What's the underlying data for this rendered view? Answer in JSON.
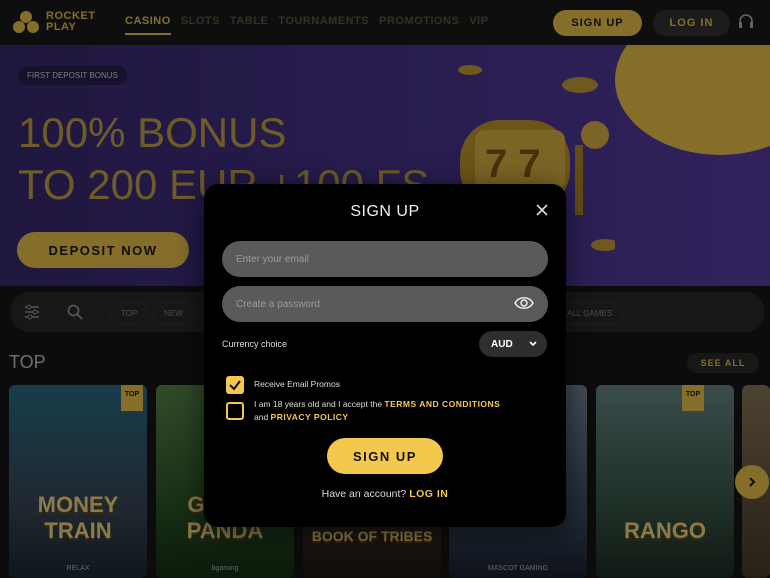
{
  "header": {
    "logo_text": [
      "ROCKET",
      "PLAY"
    ],
    "nav": [
      "CASINO",
      "SLOTS",
      "TABLE",
      "TOURNAMENTS",
      "PROMOTIONS",
      "VIP"
    ],
    "signup_label": "SIGN UP",
    "login_label": "LOG IN"
  },
  "banner": {
    "badge": "FIRST DEPOSIT BONUS",
    "promo_line1": "100% BONUS",
    "promo_line2": "TO 200 EUR +100 FS",
    "deposit_label": "DEPOSIT NOW"
  },
  "filters": {
    "chips": [
      "TOP",
      "NEW",
      "ALL GAMES"
    ]
  },
  "section": {
    "title": "TOP",
    "see_all": "SEE ALL"
  },
  "games": [
    {
      "title": "MONEY TRAIN",
      "provider": "RELAX",
      "tag": "TOP"
    },
    {
      "title": "GREAT PANDA",
      "provider": "bgaming",
      "tag": ""
    },
    {
      "title": "BOOK OF TRIBES",
      "provider": "",
      "tag": ""
    },
    {
      "title": "",
      "provider": "MASCOT GAMING",
      "tag": ""
    },
    {
      "title": "RANGO",
      "provider": "",
      "tag": "TOP"
    }
  ],
  "modal": {
    "title": "SIGN UP",
    "email_placeholder": "Enter your email",
    "password_placeholder": "Create a password",
    "currency_label": "Currency choice",
    "currency_value": "AUD",
    "promos_label": "Receive Email Promos",
    "promos_checked": true,
    "terms_text_1": "I am 18 years old and I accept the ",
    "terms_link": "TERMS AND CONDITIONS",
    "terms_text_2": "and ",
    "privacy_link": "PRIVACY POLICY",
    "terms_checked": false,
    "submit_label": "SIGN UP",
    "have_account": "Have an account?",
    "login_link": "LOG IN"
  },
  "colors": {
    "accent": "#f2c94c",
    "banner": "#4a3590",
    "modal_bg": "#000000"
  }
}
